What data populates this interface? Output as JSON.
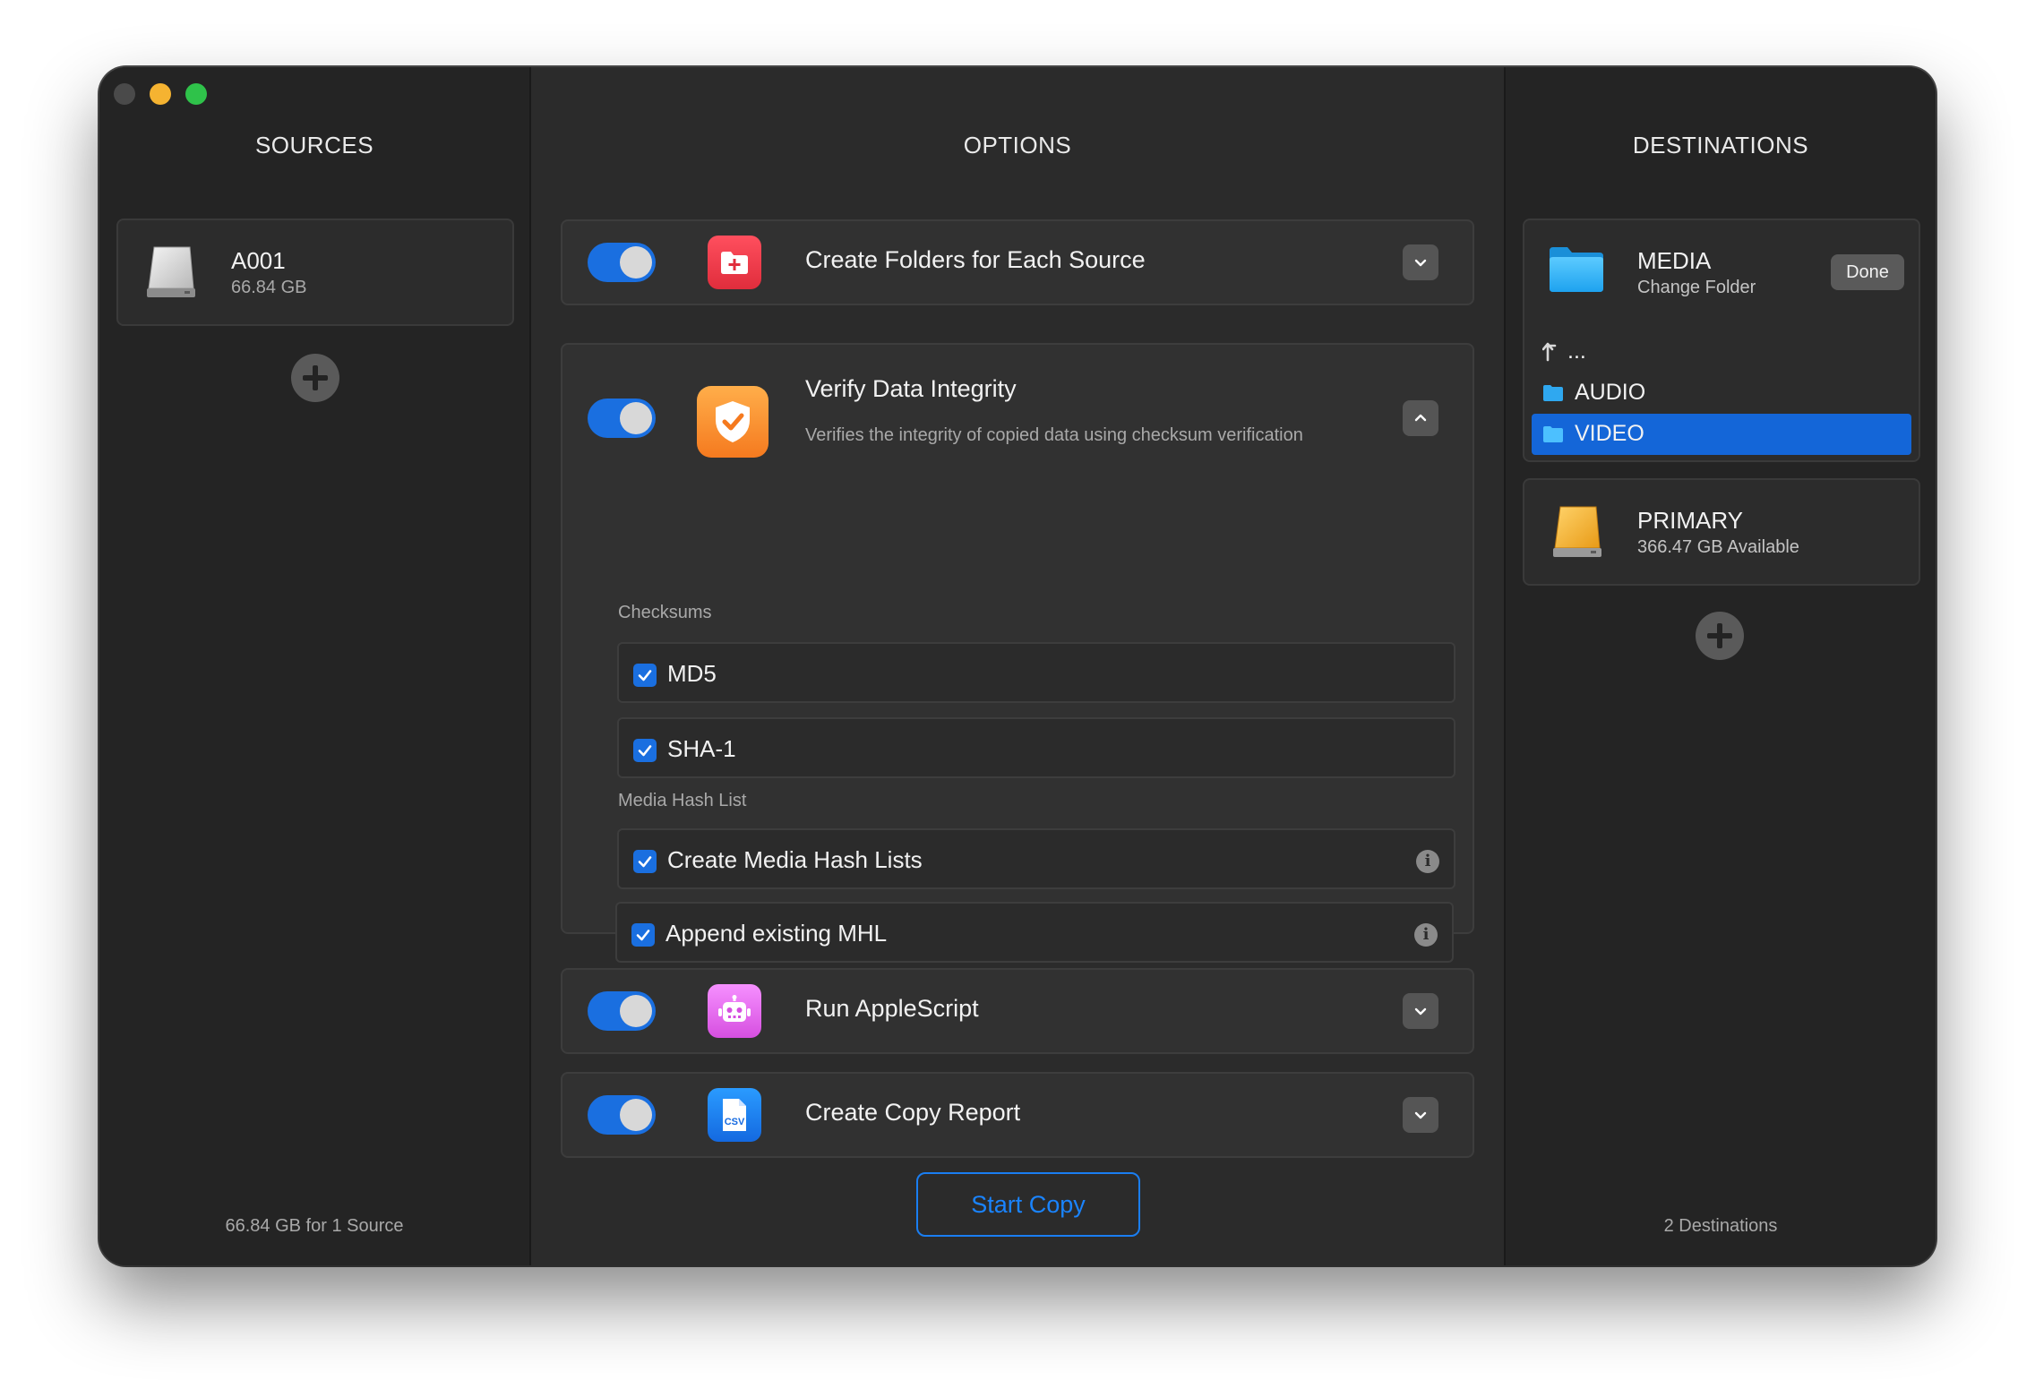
{
  "sources": {
    "title": "SOURCES",
    "items": [
      {
        "name": "A001",
        "size": "66.84 GB"
      }
    ],
    "footer": "66.84 GB for 1 Source"
  },
  "options": {
    "title": "OPTIONS",
    "items": [
      {
        "label": "Create Folders for Each Source",
        "enabled": true,
        "expanded": false
      },
      {
        "label": "Verify Data Integrity",
        "enabled": true,
        "expanded": true,
        "description": "Verifies the integrity of copied data using checksum verification"
      },
      {
        "label": "Run AppleScript",
        "enabled": true,
        "expanded": false
      },
      {
        "label": "Create Copy Report",
        "enabled": true,
        "expanded": false
      }
    ],
    "checksums_label": "Checksums",
    "checksums": [
      {
        "label": "MD5",
        "checked": true
      },
      {
        "label": "SHA-1",
        "checked": true
      }
    ],
    "mhl_label": "Media Hash List",
    "mhl": [
      {
        "label": "Create Media Hash Lists",
        "checked": true
      },
      {
        "label": "Append existing MHL",
        "checked": true
      }
    ],
    "csv_icon_text": "CSV",
    "start_button": "Start Copy"
  },
  "destinations": {
    "title": "DESTINATIONS",
    "media": {
      "name": "MEDIA",
      "sub": "Change Folder",
      "done": "Done",
      "up_label": "...",
      "folders": [
        {
          "name": "AUDIO",
          "selected": false
        },
        {
          "name": "VIDEO",
          "selected": true
        }
      ]
    },
    "primary": {
      "name": "PRIMARY",
      "sub": "366.47 GB Available"
    },
    "footer": "2 Destinations"
  },
  "colors": {
    "accent": "#1a6fe0",
    "selection": "#1466d8",
    "button_blue": "#1a84ff"
  }
}
